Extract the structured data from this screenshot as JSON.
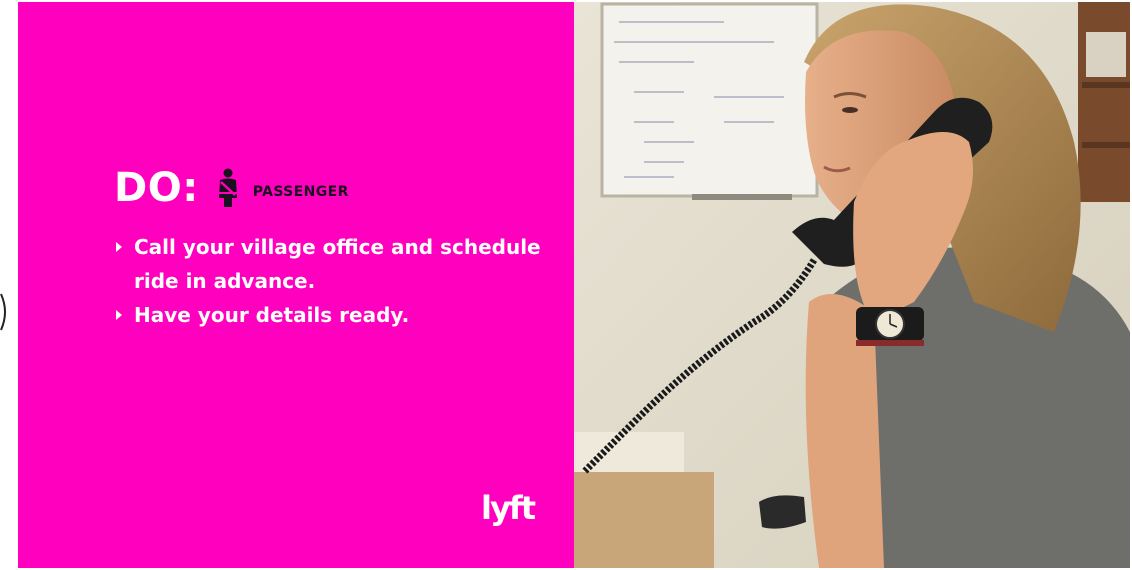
{
  "slide": {
    "heading": "DO:",
    "role_icon": "seatbelt-passenger-icon",
    "role_label": "PASSENGER",
    "bullets": [
      "Call your village office and schedule ride in advance.",
      "Have your details ready."
    ],
    "logo_text": "lyft",
    "accent_color": "#ff00bf"
  },
  "photo": {
    "subject": "woman talking on a corded desk telephone in an office"
  }
}
